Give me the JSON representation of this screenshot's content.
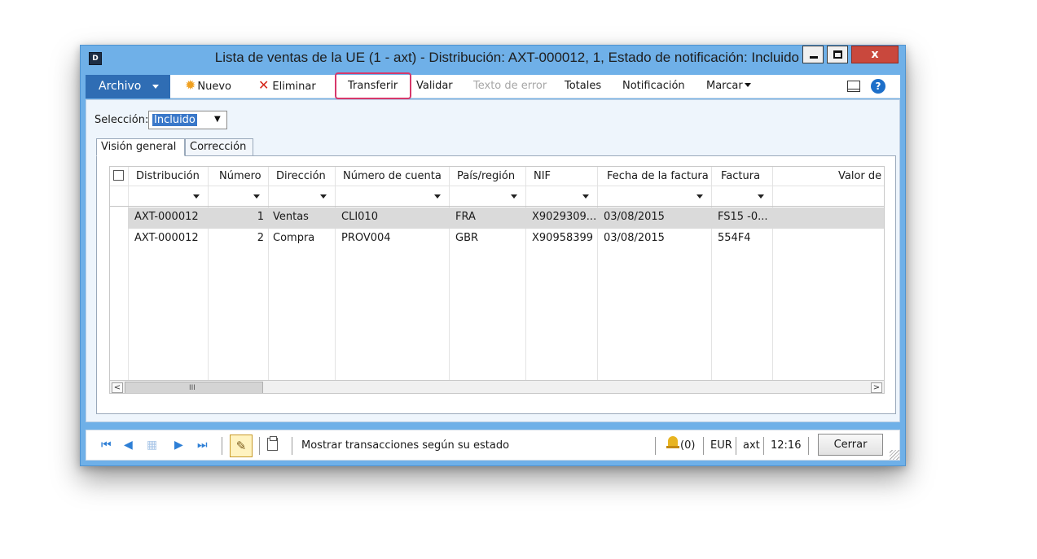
{
  "window": {
    "title": "Lista de ventas de la UE (1 - axt) - Distribución: AXT-000012, 1, Estado de notificación: Incluido",
    "close_glyph": "x"
  },
  "toolbar": {
    "archivo": "Archivo",
    "nuevo": "Nuevo",
    "eliminar": "Eliminar",
    "transferir": "Transferir",
    "validar": "Validar",
    "texto_error": "Texto de error",
    "totales": "Totales",
    "notificacion": "Notificación",
    "marcar": "Marcar",
    "help": "?"
  },
  "selection": {
    "label": "Selección:",
    "value": "Incluido"
  },
  "tabs": [
    {
      "label": "Visión general",
      "active": true
    },
    {
      "label": "Corrección",
      "active": false
    }
  ],
  "grid": {
    "columns": [
      "Distribución",
      "Número",
      "Dirección",
      "Número de cuenta",
      "País/región",
      "NIF",
      "Fecha de la factura",
      "Factura",
      "Valor de"
    ],
    "rows": [
      {
        "distribucion": "AXT-000012",
        "numero": "1",
        "direccion": "Ventas",
        "cuenta": "CLI010",
        "pais": "FRA",
        "nif": "X9029309...",
        "fecha": "03/08/2015",
        "factura": "FS15 -0..."
      },
      {
        "distribucion": "AXT-000012",
        "numero": "2",
        "direccion": "Compra",
        "cuenta": "PROV004",
        "pais": "GBR",
        "nif": "X90958399",
        "fecha": "03/08/2015",
        "factura": "554F4"
      }
    ],
    "scroll_left": "<",
    "scroll_right": ">",
    "scroll_grip": "III"
  },
  "status": {
    "nav": {
      "first": "⏮",
      "prev": "◀",
      "list": "▦",
      "next": "▶",
      "last": "⏭"
    },
    "pencil": "✎",
    "text": "Mostrar transacciones según su estado",
    "alerts": "(0)",
    "currency": "EUR",
    "company": "axt",
    "time": "12:16",
    "close": "Cerrar"
  }
}
